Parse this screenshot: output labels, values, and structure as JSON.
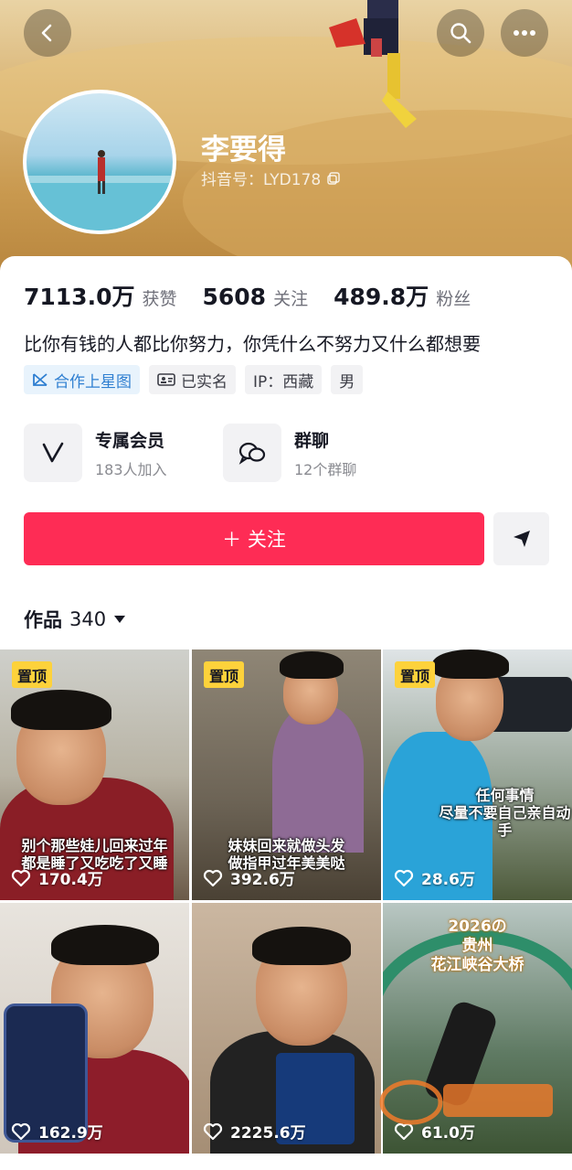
{
  "profile": {
    "name": "李要得",
    "douyin_id": "抖音号：LYD178"
  },
  "stats": [
    {
      "value": "7113.0万",
      "label": "获赞"
    },
    {
      "value": "5608",
      "label": "关注"
    },
    {
      "value": "489.8万",
      "label": "粉丝"
    }
  ],
  "bio": "比你有钱的人都比你努力，你凭什么不努力又什么都想要",
  "tags": [
    {
      "label": "合作上星图",
      "icon": "star-map-icon",
      "color": "#2f7fd1"
    },
    {
      "label": "已实名",
      "icon": "id-card-icon"
    },
    {
      "label": "IP：西藏"
    },
    {
      "label": "男"
    }
  ],
  "features": [
    {
      "title": "专属会员",
      "subtitle": "183人加入",
      "icon": "vip-v-icon"
    },
    {
      "title": "群聊",
      "subtitle": "12个群聊",
      "icon": "group-chat-icon"
    }
  ],
  "actions": {
    "follow_label": "＋ 关注"
  },
  "works": {
    "label": "作品",
    "count": "340"
  },
  "videos": [
    {
      "pinned": "置顶",
      "caption": "别个那些娃儿回来过年\n都是睡了又吃吃了又睡",
      "likes": "170.4万"
    },
    {
      "pinned": "置顶",
      "caption": "妹妹回来就做头发\n做指甲过年美美哒",
      "likes": "392.6万"
    },
    {
      "pinned": "置顶",
      "caption": "任何事情\n尽量不要自己亲自动手",
      "likes": "28.6万"
    },
    {
      "caption": "",
      "likes": "162.9万"
    },
    {
      "caption": "",
      "likes": "2225.6万"
    },
    {
      "caption": "2026の\n贵州\n花江峡谷大桥",
      "likes": "61.0万"
    }
  ],
  "colors": {
    "accent": "#fe2c55",
    "pin": "#fdd23b"
  }
}
